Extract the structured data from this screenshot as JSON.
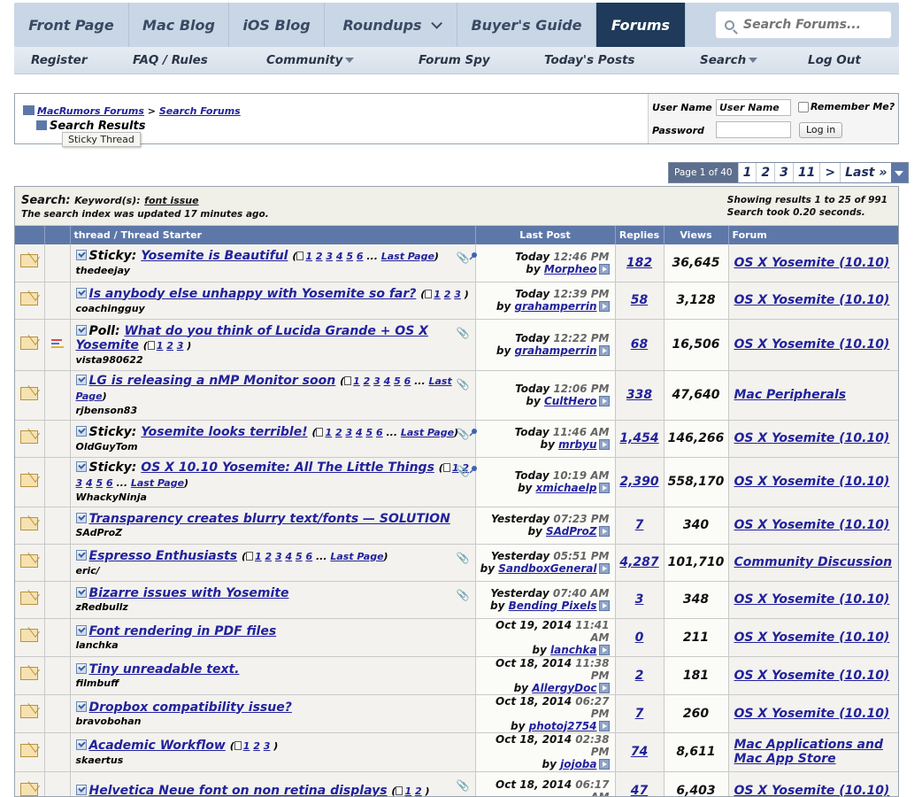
{
  "topnav": {
    "tabs": [
      "Front Page",
      "Mac Blog",
      "iOS Blog",
      "Roundups",
      "Buyer's Guide",
      "Forums"
    ],
    "active": "Forums",
    "search_placeholder": "Search Forums..."
  },
  "subnav": {
    "register": "Register",
    "faq": "FAQ / Rules",
    "community": "Community",
    "forum_spy": "Forum Spy",
    "todays_posts": "Today's Posts",
    "search": "Search",
    "logout": "Log Out"
  },
  "breadcrumb": {
    "root": "MacRumors Forums",
    "sep": ">",
    "parent": "Search Forums",
    "title": "Search Results",
    "tooltip": "Sticky Thread"
  },
  "login": {
    "username_label": "User Name",
    "username_value": "User Name",
    "remember_label": "Remember Me?",
    "password_label": "Password",
    "login_button": "Log in"
  },
  "pager": {
    "info": "Page 1 of 40",
    "pages": [
      "1",
      "2",
      "3",
      "11",
      ">",
      "Last »"
    ]
  },
  "results_header": {
    "search_label": "Search:",
    "keyword_label": "Keyword(s):",
    "keyword": "font issue",
    "index_note": "The search index was updated 17 minutes ago.",
    "showing": "Showing results 1 to 25 of 991",
    "took": "Search took 0.20 seconds."
  },
  "columns": {
    "thread": "thread / Thread Starter",
    "last_post": "Last Post",
    "replies": "Replies",
    "views": "Views",
    "forum": "Forum"
  },
  "threads": [
    {
      "prefix": "Sticky:",
      "title": "Yosemite is Beautiful",
      "pages": [
        "1",
        "2",
        "3",
        "4",
        "5",
        "6"
      ],
      "last_page": "Last Page",
      "starter": "thedeejay",
      "date": "Today",
      "time": "12:46 PM",
      "by": "Morpheo",
      "replies": "182",
      "views": "36,645",
      "forum": "OS X Yosemite (10.10)",
      "icon": "envelope-icon",
      "clip": true,
      "pin": true
    },
    {
      "prefix": "",
      "title": "Is anybody else unhappy with Yosemite so far?",
      "pages": [
        "1",
        "2",
        "3"
      ],
      "last_page": "",
      "starter": "coachingguy",
      "date": "Today",
      "time": "12:39 PM",
      "by": "grahamperrin",
      "replies": "58",
      "views": "3,128",
      "forum": "OS X Yosemite (10.10)",
      "icon": "envelope-icon",
      "clip": false,
      "pin": false
    },
    {
      "prefix": "Poll:",
      "title": "What do you think of Lucida Grande + OS X Yosemite",
      "pages": [
        "1",
        "2",
        "3"
      ],
      "last_page": "",
      "starter": "vista980622",
      "date": "Today",
      "time": "12:22 PM",
      "by": "grahamperrin",
      "replies": "68",
      "views": "16,506",
      "forum": "OS X Yosemite (10.10)",
      "icon": "envelope-icon",
      "clip": true,
      "pin": false
    },
    {
      "prefix": "",
      "title": "LG is releasing a nMP Monitor soon",
      "pages": [
        "1",
        "2",
        "3",
        "4",
        "5",
        "6"
      ],
      "last_page": "Last Page",
      "starter": "rjbenson83",
      "date": "Today",
      "time": "12:06 PM",
      "by": "CultHero",
      "replies": "338",
      "views": "47,640",
      "forum": "Mac Peripherals",
      "icon": "envelope-icon",
      "clip": true,
      "pin": false
    },
    {
      "prefix": "Sticky:",
      "title": "Yosemite looks terrible!",
      "pages": [
        "1",
        "2",
        "3",
        "4",
        "5",
        "6"
      ],
      "last_page": "Last Page",
      "starter": "OldGuyTom",
      "date": "Today",
      "time": "11:46 AM",
      "by": "mrbyu",
      "replies": "1,454",
      "views": "146,266",
      "forum": "OS X Yosemite (10.10)",
      "icon": "envelope-icon",
      "clip": true,
      "pin": true
    },
    {
      "prefix": "Sticky:",
      "title": "OS X 10.10 Yosemite: All The Little Things",
      "pages": [
        "1",
        "2",
        "3",
        "4",
        "5",
        "6"
      ],
      "last_page": "Last Page",
      "starter": "WhackyNinja",
      "date": "Today",
      "time": "10:19 AM",
      "by": "xmichaelp",
      "replies": "2,390",
      "views": "558,170",
      "forum": "OS X Yosemite (10.10)",
      "icon": "envelope-icon",
      "clip": true,
      "pin": true
    },
    {
      "prefix": "",
      "title": "Transparency creates blurry text/fonts — SOLUTION",
      "pages": [],
      "last_page": "",
      "starter": "SAdProZ",
      "date": "Yesterday",
      "time": "07:23 PM",
      "by": "SAdProZ",
      "replies": "7",
      "views": "340",
      "forum": "OS X Yosemite (10.10)",
      "icon": "envelope-icon",
      "clip": false,
      "pin": false
    },
    {
      "prefix": "",
      "title": "Espresso Enthusiasts",
      "pages": [
        "1",
        "2",
        "3",
        "4",
        "5",
        "6"
      ],
      "last_page": "Last Page",
      "starter": "eric/",
      "date": "Yesterday",
      "time": "05:51 PM",
      "by": "SandboxGeneral",
      "replies": "4,287",
      "views": "101,710",
      "forum": "Community Discussion",
      "icon": "envelope-icon",
      "clip": true,
      "pin": false
    },
    {
      "prefix": "",
      "title": "Bizarre issues with Yosemite",
      "pages": [],
      "last_page": "",
      "starter": "zRedbullz",
      "date": "Yesterday",
      "time": "07:40 AM",
      "by": "Bending Pixels",
      "replies": "3",
      "views": "348",
      "forum": "OS X Yosemite (10.10)",
      "icon": "envelope-icon",
      "clip": true,
      "pin": false
    },
    {
      "prefix": "",
      "title": "Font rendering in PDF files",
      "pages": [],
      "last_page": "",
      "starter": "lanchka",
      "date": "Oct 19, 2014",
      "time": "11:41 AM",
      "by": "lanchka",
      "replies": "0",
      "views": "211",
      "forum": "OS X Yosemite (10.10)",
      "icon": "envelope-icon",
      "clip": false,
      "pin": false
    },
    {
      "prefix": "",
      "title": "Tiny unreadable text.",
      "pages": [],
      "last_page": "",
      "starter": "filmbuff",
      "date": "Oct 18, 2014",
      "time": "11:38 PM",
      "by": "AllergyDoc",
      "replies": "2",
      "views": "181",
      "forum": "OS X Yosemite (10.10)",
      "icon": "envelope-icon",
      "clip": false,
      "pin": false
    },
    {
      "prefix": "",
      "title": "Dropbox compatibility issue?",
      "pages": [],
      "last_page": "",
      "starter": "bravobohan",
      "date": "Oct 18, 2014",
      "time": "06:27 PM",
      "by": "photoj2754",
      "replies": "7",
      "views": "260",
      "forum": "OS X Yosemite (10.10)",
      "icon": "envelope-icon",
      "clip": false,
      "pin": false
    },
    {
      "prefix": "",
      "title": "Academic Workflow",
      "pages": [
        "1",
        "2",
        "3"
      ],
      "last_page": "",
      "starter": "skaertus",
      "date": "Oct 18, 2014",
      "time": "02:38 PM",
      "by": "jojoba",
      "replies": "74",
      "views": "8,611",
      "forum": "Mac Applications and Mac App Store",
      "icon": "envelope-icon",
      "clip": false,
      "pin": false
    },
    {
      "prefix": "",
      "title": "Helvetica Neue font on non retina displays",
      "pages": [
        "1",
        "2"
      ],
      "last_page": "",
      "starter": "",
      "date": "Oct 18, 2014",
      "time": "06:17 AM",
      "by": "",
      "replies": "47",
      "views": "6,403",
      "forum": "OS X Yosemite (10.10)",
      "icon": "envelope-icon",
      "clip": true,
      "pin": false
    }
  ]
}
